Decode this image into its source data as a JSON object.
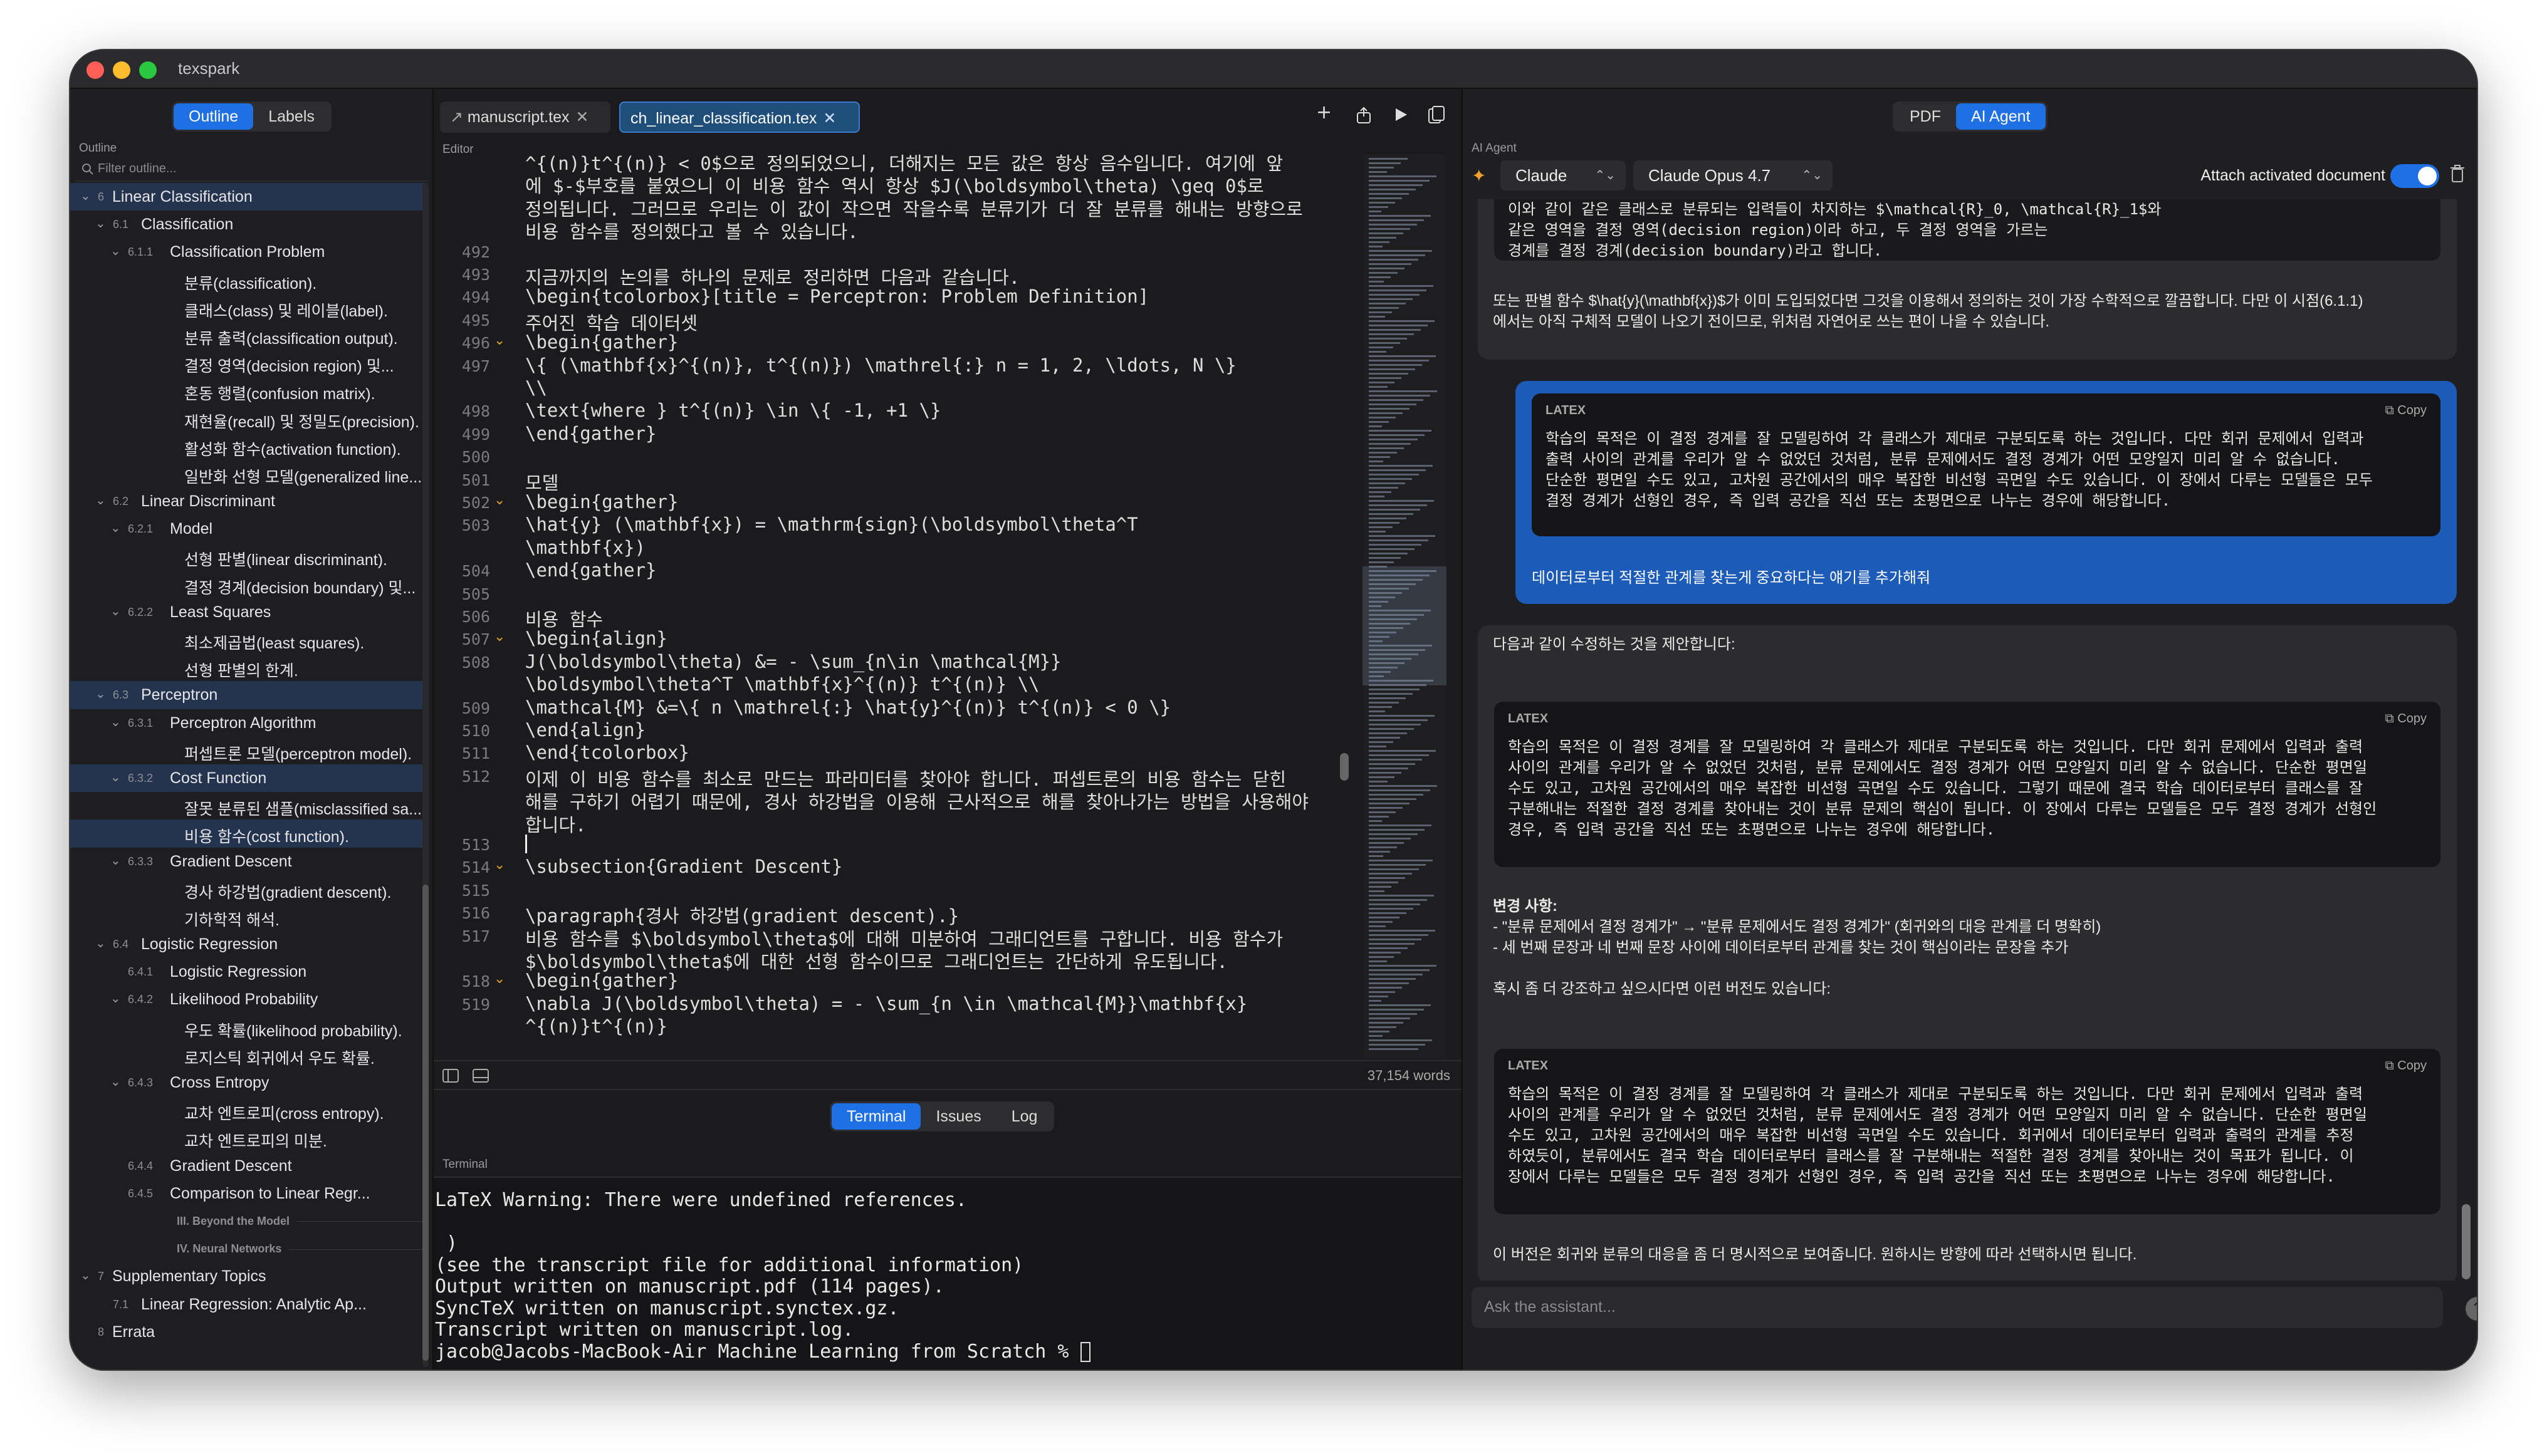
{
  "window": {
    "title": "texspark"
  },
  "left": {
    "tabs": [
      "Outline",
      "Labels"
    ],
    "section_header": "Outline",
    "filter_placeholder": "Filter outline...",
    "outline": [
      {
        "lvl": 0,
        "chev": "v",
        "num": "6",
        "label": "Linear Classification",
        "hl": true
      },
      {
        "lvl": 1,
        "chev": "v",
        "num": "6.1",
        "label": "Classification"
      },
      {
        "lvl": 2,
        "chev": "v",
        "num": "6.1.1",
        "label": "Classification Problem"
      },
      {
        "lvl": 3,
        "label": "분류(classification)."
      },
      {
        "lvl": 3,
        "label": "클래스(class) 및 레이블(label)."
      },
      {
        "lvl": 3,
        "label": "분류 출력(classification output)."
      },
      {
        "lvl": 3,
        "label": "결정 영역(decision region) 및..."
      },
      {
        "lvl": 3,
        "label": "혼동 행렬(confusion matrix)."
      },
      {
        "lvl": 3,
        "label": "재현율(recall) 및 정밀도(precision)."
      },
      {
        "lvl": 3,
        "label": "활성화 함수(activation function)."
      },
      {
        "lvl": 3,
        "label": "일반화 선형 모델(generalized line..."
      },
      {
        "lvl": 1,
        "chev": "v",
        "num": "6.2",
        "label": "Linear Discriminant"
      },
      {
        "lvl": 2,
        "chev": "v",
        "num": "6.2.1",
        "label": "Model"
      },
      {
        "lvl": 3,
        "label": "선형 판별(linear discriminant)."
      },
      {
        "lvl": 3,
        "label": "결정 경계(decision boundary) 및..."
      },
      {
        "lvl": 2,
        "chev": "v",
        "num": "6.2.2",
        "label": "Least Squares"
      },
      {
        "lvl": 3,
        "label": "최소제곱법(least squares)."
      },
      {
        "lvl": 3,
        "label": "선형 판별의 한계."
      },
      {
        "lvl": 1,
        "chev": "v",
        "num": "6.3",
        "label": "Perceptron",
        "hl": true
      },
      {
        "lvl": 2,
        "chev": "v",
        "num": "6.3.1",
        "label": "Perceptron Algorithm"
      },
      {
        "lvl": 3,
        "label": "퍼셉트론 모델(perceptron model)."
      },
      {
        "lvl": 2,
        "chev": "v",
        "num": "6.3.2",
        "label": "Cost Function",
        "hl": true
      },
      {
        "lvl": 3,
        "label": "잘못 분류된 샘플(misclassified sa..."
      },
      {
        "lvl": 3,
        "label": "비용 함수(cost function).",
        "hl": true
      },
      {
        "lvl": 2,
        "chev": "v",
        "num": "6.3.3",
        "label": "Gradient Descent"
      },
      {
        "lvl": 3,
        "label": "경사 하강법(gradient descent)."
      },
      {
        "lvl": 3,
        "label": "기하학적 해석."
      },
      {
        "lvl": 1,
        "chev": "v",
        "num": "6.4",
        "label": "Logistic Regression"
      },
      {
        "lvl": 2,
        "num": "6.4.1",
        "label": "Logistic Regression"
      },
      {
        "lvl": 2,
        "chev": "v",
        "num": "6.4.2",
        "label": "Likelihood Probability"
      },
      {
        "lvl": 3,
        "label": "우도 확률(likelihood probability)."
      },
      {
        "lvl": 3,
        "label": "로지스틱 회귀에서 우도 확률."
      },
      {
        "lvl": 2,
        "chev": "v",
        "num": "6.4.3",
        "label": "Cross Entropy"
      },
      {
        "lvl": 3,
        "label": "교차 엔트로피(cross entropy)."
      },
      {
        "lvl": 3,
        "label": "교차 엔트로피의 미분."
      },
      {
        "lvl": 2,
        "num": "6.4.4",
        "label": "Gradient Descent"
      },
      {
        "lvl": 2,
        "num": "6.4.5",
        "label": "Comparison to Linear Regr..."
      },
      {
        "part": true,
        "label": "III. Beyond the Model"
      },
      {
        "part": true,
        "label": "IV. Neural Networks"
      },
      {
        "lvl": 0,
        "chev": "v",
        "num": "7",
        "label": "Supplementary Topics"
      },
      {
        "lvl": 1,
        "num": "7.1",
        "label": "Linear Regression: Analytic Ap..."
      },
      {
        "lvl": 0,
        "num": "8",
        "label": "Errata"
      }
    ]
  },
  "editor": {
    "tabs": [
      {
        "label": "manuscript.tex"
      },
      {
        "label": "ch_linear_classification.tex"
      }
    ],
    "section_header": "Editor",
    "word_count": "37,154 words",
    "lines": [
      {
        "n": "",
        "t": "^{(n)}t^{(n)} < 0$으로 정의되었으니, 더해지는 모든 값은 항상 음수입니다. 여기에 앞"
      },
      {
        "n": "",
        "t": "에 $-$부호를 붙였으니 이 비용 함수 역시 항상 $J(\\boldsymbol\\theta) \\geq 0$로"
      },
      {
        "n": "",
        "t": "정의됩니다. 그러므로 우리는 이 값이 작으면 작을수록 분류기가 더 잘 분류를 해내는 방향으로"
      },
      {
        "n": "",
        "t": "비용 함수를 정의했다고 볼 수 있습니다."
      },
      {
        "n": "492",
        "t": ""
      },
      {
        "n": "493",
        "t": "지금까지의 논의를 하나의 문제로 정리하면 다음과 같습니다."
      },
      {
        "n": "494",
        "t": "\\begin{tcolorbox}[title = Perceptron: Problem Definition]"
      },
      {
        "n": "495",
        "t": "주어진 학습 데이터셋"
      },
      {
        "n": "496",
        "f": true,
        "t": "\\begin{gather}"
      },
      {
        "n": "497",
        "t": "\\{ (\\mathbf{x}^{(n)}, t^{(n)}) \\mathrel{:} n = 1, 2, \\ldots, N \\}"
      },
      {
        "n": "",
        "t": "\\\\"
      },
      {
        "n": "498",
        "t": "\\text{where } t^{(n)} \\in \\{ -1, +1 \\}"
      },
      {
        "n": "499",
        "t": "\\end{gather}"
      },
      {
        "n": "500",
        "t": ""
      },
      {
        "n": "501",
        "t": "모델"
      },
      {
        "n": "502",
        "f": true,
        "t": "\\begin{gather}"
      },
      {
        "n": "503",
        "t": "\\hat{y} (\\mathbf{x}) = \\mathrm{sign}(\\boldsymbol\\theta^T"
      },
      {
        "n": "",
        "t": "\\mathbf{x})"
      },
      {
        "n": "504",
        "t": "\\end{gather}"
      },
      {
        "n": "505",
        "t": ""
      },
      {
        "n": "506",
        "t": "비용 함수"
      },
      {
        "n": "507",
        "f": true,
        "t": "\\begin{align}"
      },
      {
        "n": "508",
        "t": "J(\\boldsymbol\\theta) &= - \\sum_{n\\in \\mathcal{M}}"
      },
      {
        "n": "",
        "t": "\\boldsymbol\\theta^T \\mathbf{x}^{(n)} t^{(n)} \\\\"
      },
      {
        "n": "509",
        "t": "\\mathcal{M} &=\\{ n \\mathrel{:} \\hat{y}^{(n)} t^{(n)} < 0 \\}"
      },
      {
        "n": "510",
        "t": "\\end{align}"
      },
      {
        "n": "511",
        "t": "\\end{tcolorbox}"
      },
      {
        "n": "512",
        "t": "이제 이 비용 함수를 최소로 만드는 파라미터를 찾아야 합니다. 퍼셉트론의 비용 함수는 닫힌"
      },
      {
        "n": "",
        "t": "해를 구하기 어렵기 때문에, 경사 하강법을 이용해 근사적으로 해를 찾아나가는 방법을 사용해야"
      },
      {
        "n": "",
        "t": "합니다."
      },
      {
        "n": "513",
        "t": ""
      },
      {
        "n": "514",
        "f": true,
        "t": "\\subsection{Gradient Descent}"
      },
      {
        "n": "515",
        "t": ""
      },
      {
        "n": "516",
        "t": "\\paragraph{경사 하강법(gradient descent).}"
      },
      {
        "n": "517",
        "t": "비용 함수를 $\\boldsymbol\\theta$에 대해 미분하여 그래디언트를 구합니다. 비용 함수가"
      },
      {
        "n": "",
        "t": "$\\boldsymbol\\theta$에 대한 선형 함수이므로 그래디언트는 간단하게 유도됩니다."
      },
      {
        "n": "518",
        "f": true,
        "t": "\\begin{gather}"
      },
      {
        "n": "519",
        "t": "\\nabla J(\\boldsymbol\\theta) = - \\sum_{n \\in \\mathcal{M}}\\mathbf{x}"
      },
      {
        "n": "",
        "t": "^{(n)}t^{(n)}"
      }
    ]
  },
  "bottom": {
    "tabs": [
      "Terminal",
      "Issues",
      "Log"
    ],
    "section_header": "Terminal",
    "lines": [
      "LaTeX Warning: There were undefined references.",
      "",
      " )",
      "(see the transcript file for additional information)",
      "Output written on manuscript.pdf (114 pages).",
      "SyncTeX written on manuscript.synctex.gz.",
      "Transcript written on manuscript.log.",
      "jacob@Jacobs-MacBook-Air Machine Learning from Scratch % "
    ]
  },
  "ai": {
    "view_tabs": [
      "PDF",
      "AI Agent"
    ],
    "section_header": "AI Agent",
    "provider": "Claude",
    "model": "Claude Opus 4.7",
    "attach_label": "Attach activated document",
    "attach_on": true,
    "ask_placeholder": "Ask the assistant...",
    "prev_code": "이와 같이 같은 클래스로 분류되는 입력들이 차지하는 $\\mathcal{R}_0, \\mathcal{R}_1$와\n같은 영역을 결정 영역(decision region)이라 하고, 두 결정 영역을 가르는\n경계를 결정 경계(decision boundary)라고 합니다.",
    "prev_text": "또는 판별 함수 $\\hat{y}(\\mathbf{x})$가 이미 도입되었다면 그것을 이용해서 정의하는 것이 가장 수학적으로 깔끔합니다. 다만 이 시점(6.1.1)\n에서는 아직 구체적 모델이 나오기 전이므로, 위처럼 자연어로 쓰는 편이 나을 수 있습니다.",
    "user_code_label": "LATEX",
    "copy_label": "Copy",
    "user_code": "학습의 목적은 이 결정 경계를 잘 모델링하여 각 클래스가 제대로 구분되도록 하는 것입니다. 다만 회귀 문제에서 입력과\n출력 사이의 관계를 우리가 알 수 없었던 것처럼, 분류 문제에서도 결정 경계가 어떤 모양일지 미리 알 수 없습니다.\n단순한 평면일 수도 있고, 고차원 공간에서의 매우 복잡한 비선형 곡면일 수도 있습니다. 이 장에서 다루는 모델들은 모두\n결정 경계가 선형인 경우, 즉 입력 공간을 직선 또는 초평면으로 나누는 경우에 해당합니다.",
    "user_text": "데이터로부터 적절한 관계를 찾는게 중요하다는 얘기를 추가해줘",
    "reply_intro": "다음과 같이 수정하는 것을 제안합니다:",
    "reply_code1": "학습의 목적은 이 결정 경계를 잘 모델링하여 각 클래스가 제대로 구분되도록 하는 것입니다. 다만 회귀 문제에서 입력과 출력\n사이의 관계를 우리가 알 수 없었던 것처럼, 분류 문제에서도 결정 경계가 어떤 모양일지 미리 알 수 없습니다. 단순한 평면일\n수도 있고, 고차원 공간에서의 매우 복잡한 비선형 곡면일 수도 있습니다. 그렇기 때문에 결국 학습 데이터로부터 클래스를 잘\n구분해내는 적절한 결정 경계를 찾아내는 것이 분류 문제의 핵심이 됩니다. 이 장에서 다루는 모델들은 모두 결정 경계가 선형인\n경우, 즉 입력 공간을 직선 또는 초평면으로 나누는 경우에 해당합니다.",
    "changes_title": "변경 사항:",
    "changes": [
      "- \"분류 문제에서 결정 경계가\" → \"분류 문제에서도 결정 경계가\" (회귀와의 대응 관계를 더 명확히)",
      "- 세 번째 문장과 네 번째 문장 사이에 데이터로부터 관계를 찾는 것이 핵심이라는 문장을 추가"
    ],
    "alt_intro": "혹시 좀 더 강조하고 싶으시다면 이런 버전도 있습니다:",
    "reply_code2": "학습의 목적은 이 결정 경계를 잘 모델링하여 각 클래스가 제대로 구분되도록 하는 것입니다. 다만 회귀 문제에서 입력과 출력\n사이의 관계를 우리가 알 수 없었던 것처럼, 분류 문제에서도 결정 경계가 어떤 모양일지 미리 알 수 없습니다. 단순한 평면일\n수도 있고, 고차원 공간에서의 매우 복잡한 비선형 곡면일 수도 있습니다. 회귀에서 데이터로부터 입력과 출력의 관계를 추정\n하였듯이, 분류에서도 결국 학습 데이터로부터 클래스를 잘 구분해내는 적절한 결정 경계를 찾아내는 것이 목표가 됩니다. 이\n장에서 다루는 모델들은 모두 결정 경계가 선형인 경우, 즉 입력 공간을 직선 또는 초평면으로 나누는 경우에 해당합니다.",
    "closing": "이 버전은 회귀와 분류의 대응을 좀 더 명시적으로 보여줍니다. 원하시는 방향에 따라 선택하시면 됩니다."
  },
  "colors": {
    "accent": "#1f6fe5",
    "close": "#ff5f57",
    "minimize": "#febc2e",
    "zoom": "#28c840",
    "fold": "#e0a030",
    "user_bubble": "#1c5cb8"
  }
}
